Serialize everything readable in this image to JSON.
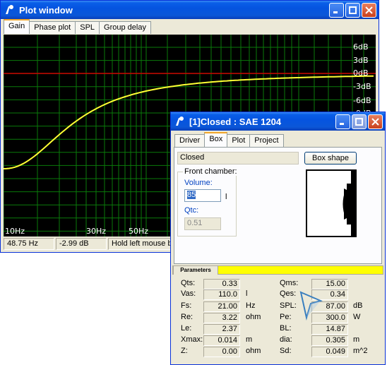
{
  "plot_window": {
    "title": "Plot window",
    "tabs": [
      "Gain",
      "Phase plot",
      "SPL",
      "Group delay"
    ],
    "y_labels": [
      "6dB",
      "3dB",
      "0dB",
      "-3dB",
      "-6dB",
      "-9dB"
    ],
    "x_labels": [
      "10Hz",
      "30Hz",
      "50Hz"
    ],
    "status": {
      "frequency": "48.75 Hz",
      "gain": "-2.99 dB",
      "hint": "Hold left mouse b"
    },
    "colors": {
      "background": "#000000",
      "grid": "#0a7a0a",
      "zero_line": "#cc0000",
      "curve": "#ffff33"
    }
  },
  "box_window": {
    "title": "[1]Closed : SAE 1204",
    "tabs": [
      "Driver",
      "Box",
      "Plot",
      "Project"
    ],
    "box_type": "Closed",
    "box_shape_label": "Box shape",
    "front_chamber_label": "Front chamber:",
    "volume_label": "Volume:",
    "volume_value": "85",
    "volume_unit": "l",
    "qtc_label": "Qtc:",
    "qtc_value": "0.51",
    "parameters_label": "Parameters",
    "params_left": [
      {
        "name": "Qts:",
        "value": "0.33",
        "unit": ""
      },
      {
        "name": "Vas:",
        "value": "110.0",
        "unit": "l"
      },
      {
        "name": "Fs:",
        "value": "21.00",
        "unit": "Hz"
      },
      {
        "name": "Re:",
        "value": "3.22",
        "unit": "ohm"
      },
      {
        "name": "Le:",
        "value": "2.37",
        "unit": ""
      },
      {
        "name": "Xmax:",
        "value": "0.014",
        "unit": "m"
      },
      {
        "name": "Z:",
        "value": "0.00",
        "unit": "ohm"
      }
    ],
    "params_right": [
      {
        "name": "Qms:",
        "value": "15.00",
        "unit": ""
      },
      {
        "name": "Qes:",
        "value": "0.34",
        "unit": ""
      },
      {
        "name": "SPL:",
        "value": "87.00",
        "unit": "dB"
      },
      {
        "name": "Pe:",
        "value": "300.0",
        "unit": "W"
      },
      {
        "name": "BL:",
        "value": "14.87",
        "unit": ""
      },
      {
        "name": "dia:",
        "value": "0.305",
        "unit": "m"
      },
      {
        "name": "Sd:",
        "value": "0.049",
        "unit": "m^2"
      }
    ]
  }
}
